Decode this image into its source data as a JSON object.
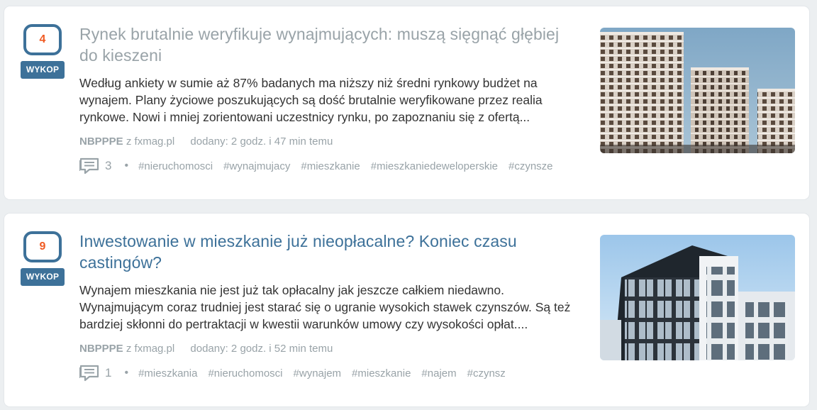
{
  "items": [
    {
      "votes": "4",
      "vote_button": "WYKOP",
      "title": "Rynek brutalnie weryfikuje wynajmujących: muszą sięgnąć głębiej do kieszeni",
      "excerpt": "Według ankiety w sumie aż 87% badanych ma niższy niż średni rynkowy budżet na wynajem. Plany życiowe poszukujących są dość brutalnie weryfikowane przez realia rynkowe. Nowi i mniej zorientowani uczestnicy rynku, po zapoznaniu się z ofertą...",
      "author": "NBPPPE",
      "source_prefix": "z fxmag.pl",
      "added": "dodany: 2 godz. i 47 min temu",
      "comments": "3",
      "dot": "•",
      "tags": [
        "#nieruchomosci",
        "#wynajmujacy",
        "#mieszkanie",
        "#mieszkaniedeweloperskie",
        "#czynsze"
      ]
    },
    {
      "votes": "9",
      "vote_button": "WYKOP",
      "title": "Inwestowanie w mieszkanie już nieopłacalne? Koniec czasu castingów?",
      "excerpt": "Wynajem mieszkania nie jest już tak opłacalny jak jeszcze całkiem niedawno. Wynajmującym coraz trudniej jest starać się o ugranie wysokich stawek czynszów. Są też bardziej skłonni do pertraktacji w kwestii warunków umowy czy wysokości opłat....",
      "author": "NBPPPE",
      "source_prefix": "z fxmag.pl",
      "added": "dodany: 2 godz. i 52 min temu",
      "comments": "1",
      "dot": "•",
      "tags": [
        "#mieszkania",
        "#nieruchomosci",
        "#wynajem",
        "#mieszkanie",
        "#najem",
        "#czynsz"
      ]
    }
  ],
  "colors": {
    "accent": "#3d7199",
    "vote_count": "#f05a22",
    "muted": "#99a3a8",
    "visited_title": "#99a3a8"
  },
  "icons": {
    "comments": "comment-bubble-icon"
  }
}
